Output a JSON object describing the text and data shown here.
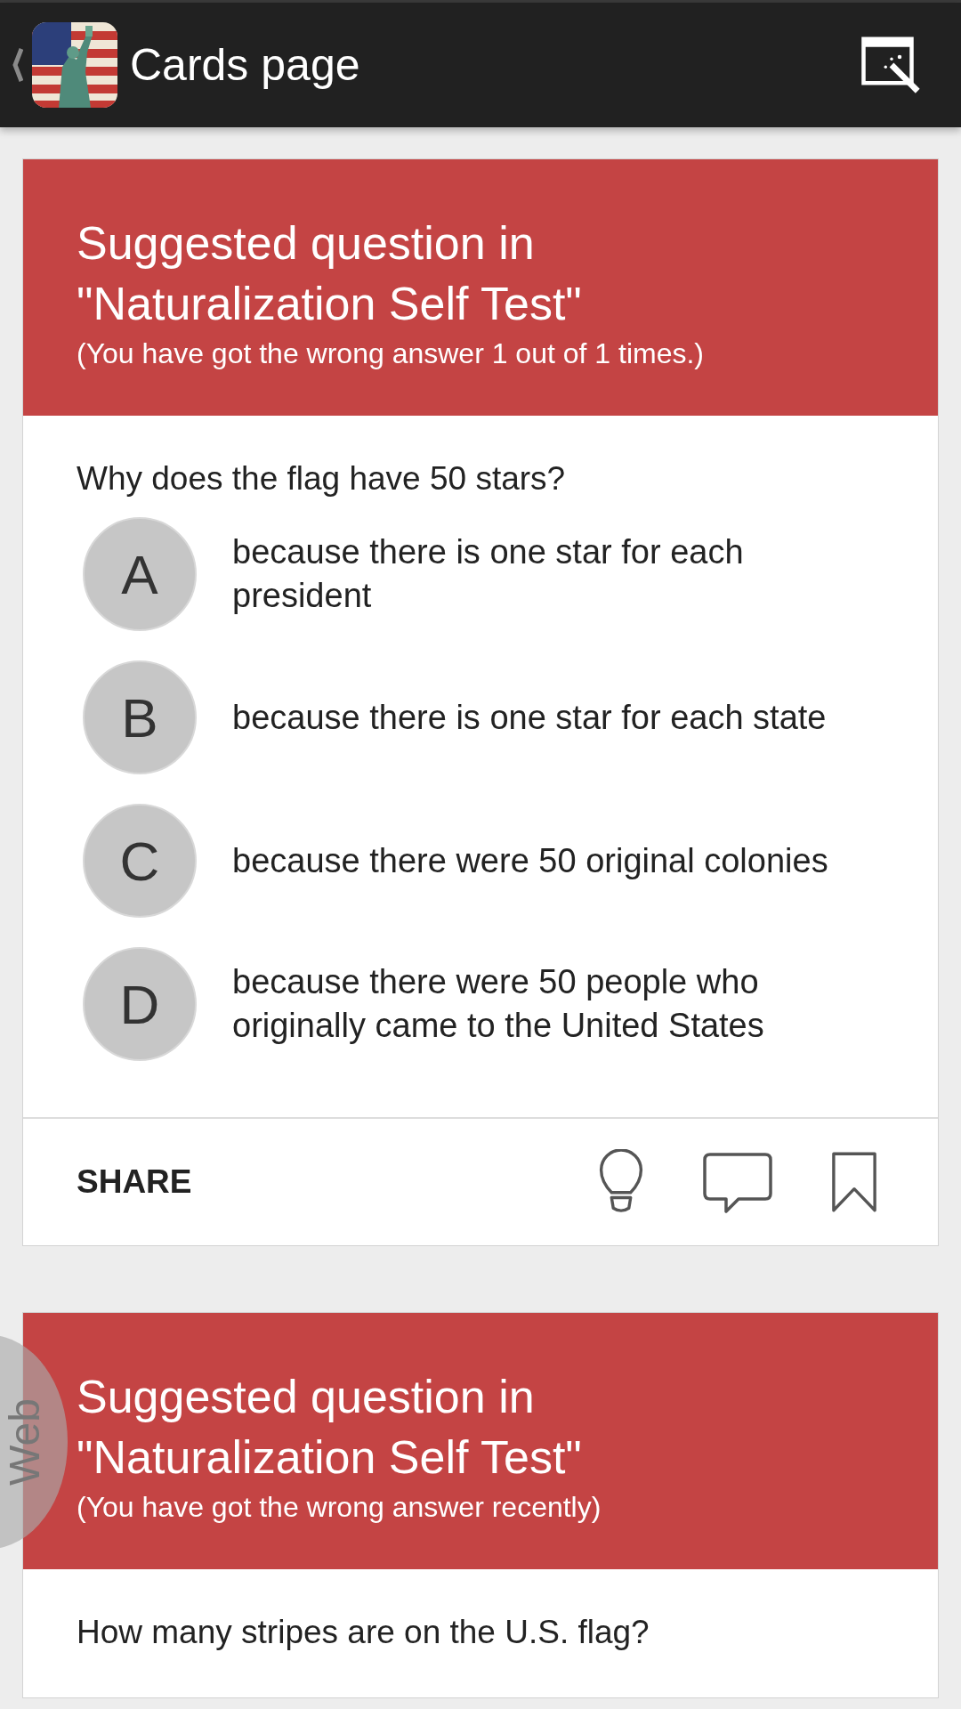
{
  "app_bar": {
    "title": "Cards page"
  },
  "cards": [
    {
      "title_lines": [
        "Suggested question in",
        "\"Naturalization Self Test\""
      ],
      "subtitle": "(You have got the wrong answer 1 out of 1 times.)",
      "question": "Why does the flag have 50 stars?",
      "options": [
        {
          "letter": "A",
          "text": "because there is one star for each president"
        },
        {
          "letter": "B",
          "text": "because there is one star for each state"
        },
        {
          "letter": "C",
          "text": "because there were 50 original colonies"
        },
        {
          "letter": "D",
          "text": "because there were 50 people who originally came to the United States"
        }
      ],
      "footer": {
        "share": "SHARE"
      }
    },
    {
      "title_lines": [
        "Suggested question in",
        "\"Naturalization Self Test\""
      ],
      "subtitle": "(You have got the wrong answer recently)",
      "question": "How many stripes are on the U.S. flag?"
    }
  ],
  "side_tab": {
    "label": "Web"
  }
}
